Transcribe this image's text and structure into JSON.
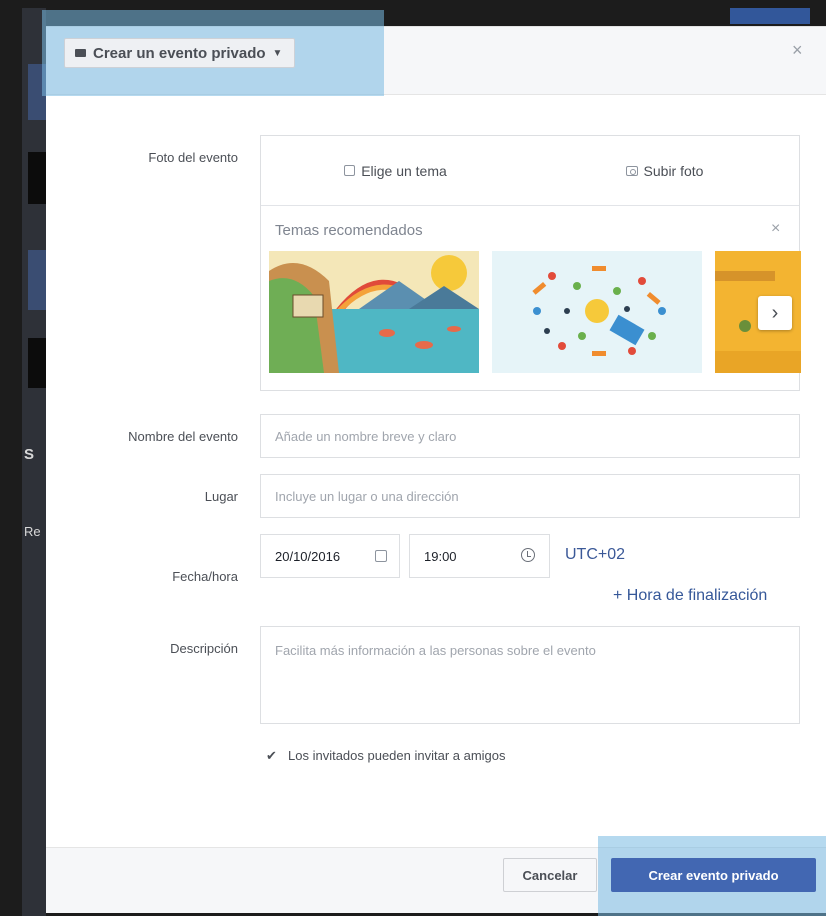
{
  "header": {
    "event_type_label": "Crear un evento privado",
    "close_symbol": "×"
  },
  "background": {
    "letter_s": "S",
    "letter_re": "Re"
  },
  "form": {
    "photo_label": "Foto del evento",
    "choose_theme": "Elige un tema",
    "upload_photo": "Subir foto",
    "recommended_themes": "Temas recomendados",
    "themes_close": "×",
    "next_arrow": "›",
    "name_label": "Nombre del evento",
    "name_placeholder": "Añade un nombre breve y claro",
    "place_label": "Lugar",
    "place_placeholder": "Incluye un lugar o una dirección",
    "datetime_label": "Fecha/hora",
    "date_value": "20/10/2016",
    "time_value": "19:00",
    "timezone": "UTC+02",
    "end_time_link": "+ Hora de finalización",
    "description_label": "Descripción",
    "description_placeholder": "Facilita más información a las personas sobre el evento",
    "guests_can_invite_checked": true,
    "guests_can_invite_label": "Los invitados pueden invitar a amigos"
  },
  "footer": {
    "cancel_label": "Cancelar",
    "create_label": "Crear evento privado"
  },
  "colors": {
    "primary_button": "#4267b2",
    "link": "#365899",
    "highlight": "#78b9e1"
  }
}
